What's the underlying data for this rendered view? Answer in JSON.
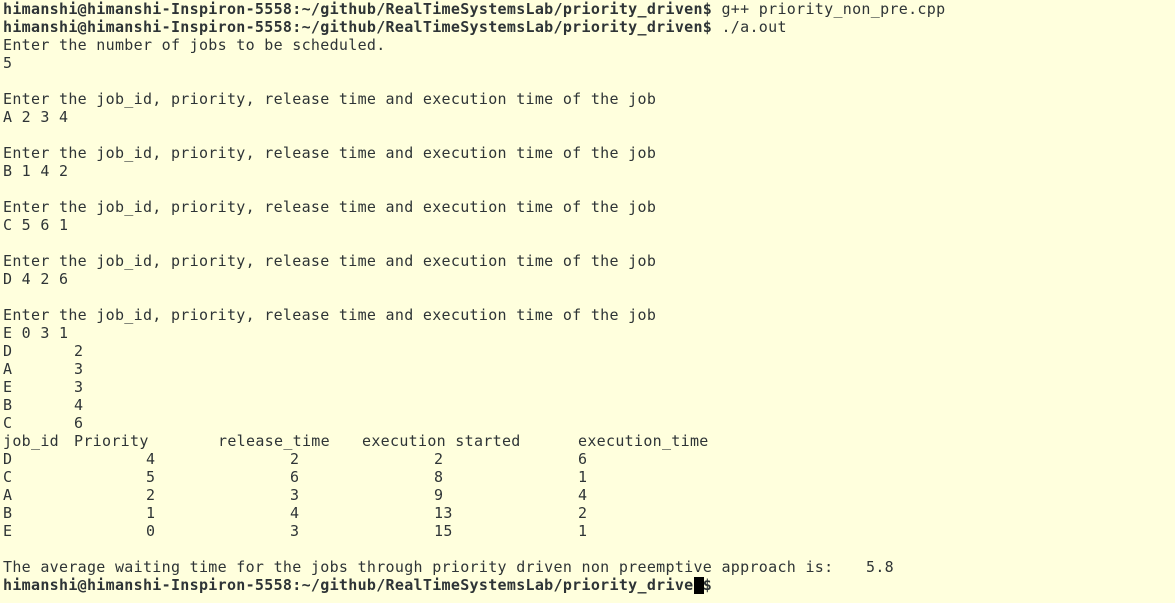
{
  "terminal": {
    "cmd1": {
      "prompt": "himanshi@himanshi-Inspiron-5558:~/github/RealTimeSystemsLab/priority_driven$",
      "command": " g++ priority_non_pre.cpp"
    },
    "cmd2": {
      "prompt": "himanshi@himanshi-Inspiron-5558:~/github/RealTimeSystemsLab/priority_driven$",
      "command": " ./a.out"
    },
    "ask_count": "Enter the number of jobs to be scheduled.",
    "count_input": "5",
    "ask_job": "Enter the job_id, priority, release time and execution time of the job",
    "job_inputs": [
      "A 2 3 4",
      "B 1 4 2",
      "C 5 6 1",
      "D 4 2 6",
      "E 0 3 1"
    ],
    "sorted_list": [
      {
        "id": "D",
        "value": "2"
      },
      {
        "id": "A",
        "value": "3"
      },
      {
        "id": "E",
        "value": "3"
      },
      {
        "id": "B",
        "value": "4"
      },
      {
        "id": "C",
        "value": "6"
      }
    ],
    "table": {
      "headers": [
        "job_id",
        "Priority",
        "release_time",
        "execution started",
        "execution_time"
      ],
      "rows": [
        [
          "D",
          "4",
          "2",
          "2",
          "6"
        ],
        [
          "C",
          "5",
          "6",
          "8",
          "1"
        ],
        [
          "A",
          "2",
          "3",
          "9",
          "4"
        ],
        [
          "B",
          "1",
          "4",
          "13",
          "2"
        ],
        [
          "E",
          "0",
          "3",
          "15",
          "1"
        ]
      ]
    },
    "result_text": "The average waiting time for the jobs through priority driven non preemptive approach is:",
    "result_value": "5.8",
    "final_prompt": "himanshi@himanshi-Inspiron-5558:~/github/RealTimeSystemsLab/priority_driven$"
  }
}
